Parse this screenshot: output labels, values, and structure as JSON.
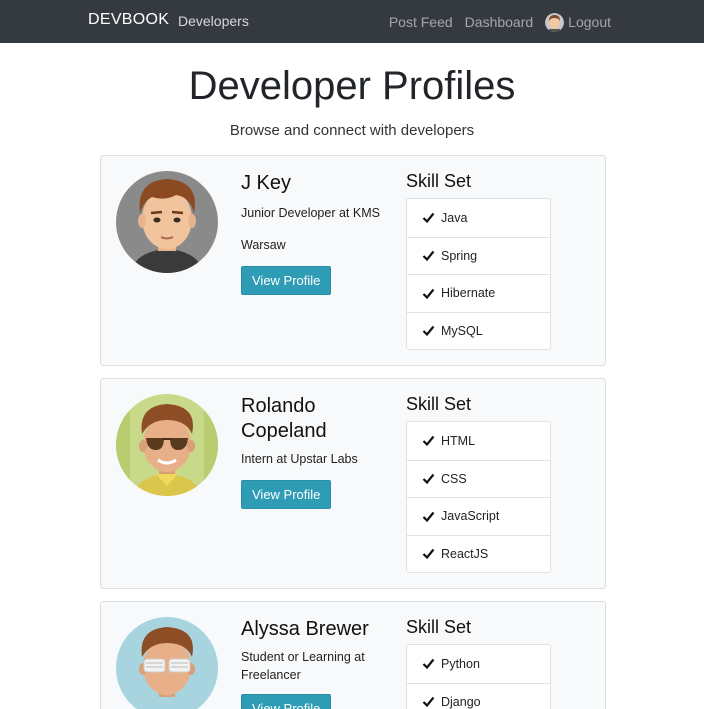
{
  "navbar": {
    "brand": "DEVBOOK",
    "developers_link": "Developers",
    "post_feed_link": "Post Feed",
    "dashboard_link": "Dashboard",
    "logout_link": "Logout"
  },
  "header": {
    "title": "Developer Profiles",
    "subtitle": "Browse and connect with developers"
  },
  "profiles": [
    {
      "name": "J Key",
      "role": "Junior Developer at KMS",
      "location": "Warsaw",
      "button": "View Profile",
      "skills_title": "Skill Set",
      "skills": [
        "Java",
        "Spring",
        "Hibernate",
        "MySQL"
      ]
    },
    {
      "name": "Rolando Copeland",
      "role": "Intern at Upstar Labs",
      "location": "",
      "button": "View Profile",
      "skills_title": "Skill Set",
      "skills": [
        "HTML",
        "CSS",
        "JavaScript",
        "ReactJS"
      ]
    },
    {
      "name": "Alyssa Brewer",
      "role": "Student or Learning at Freelancer",
      "location": "",
      "button": "View Profile",
      "skills_title": "Skill Set",
      "skills": [
        "Python",
        "Django"
      ]
    }
  ],
  "colors": {
    "navbar_bg": "#343a40",
    "button_bg": "#2f9cb5",
    "card_bg": "#f8f9fa"
  },
  "icons": {
    "skill_check": "check-icon",
    "nav_avatar": "user-avatar-icon"
  }
}
